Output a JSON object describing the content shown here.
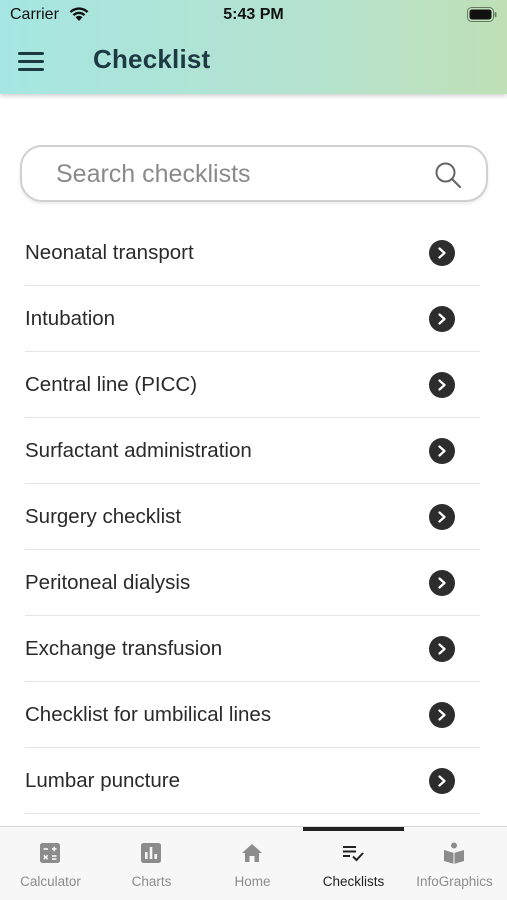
{
  "status_bar": {
    "carrier": "Carrier",
    "time": "5:43 PM"
  },
  "header": {
    "title": "Checklist",
    "menu_icon": "hamburger-menu-icon"
  },
  "search": {
    "placeholder": "Search checklists",
    "value": "",
    "icon": "search-icon"
  },
  "checklists": [
    {
      "label": "Neonatal transport"
    },
    {
      "label": "Intubation"
    },
    {
      "label": "Central line (PICC)"
    },
    {
      "label": "Surfactant administration"
    },
    {
      "label": "Surgery checklist"
    },
    {
      "label": "Peritoneal dialysis"
    },
    {
      "label": "Exchange transfusion"
    },
    {
      "label": "Checklist for umbilical lines"
    },
    {
      "label": "Lumbar puncture"
    }
  ],
  "tabs": [
    {
      "label": "Calculator",
      "icon": "calculator-icon",
      "active": false
    },
    {
      "label": "Charts",
      "icon": "chart-icon",
      "active": false
    },
    {
      "label": "Home",
      "icon": "home-icon",
      "active": false
    },
    {
      "label": "Checklists",
      "icon": "checklist-icon",
      "active": true
    },
    {
      "label": "InfoGraphics",
      "icon": "infographics-icon",
      "active": false
    }
  ],
  "colors": {
    "header_gradient_start": "#a6e6e2",
    "header_gradient_end": "#bfe0b6",
    "title_text": "#1d3a44",
    "chevron_button": "#2d2d2d",
    "tab_inactive": "#8c8c8c",
    "tab_active": "#222222"
  }
}
